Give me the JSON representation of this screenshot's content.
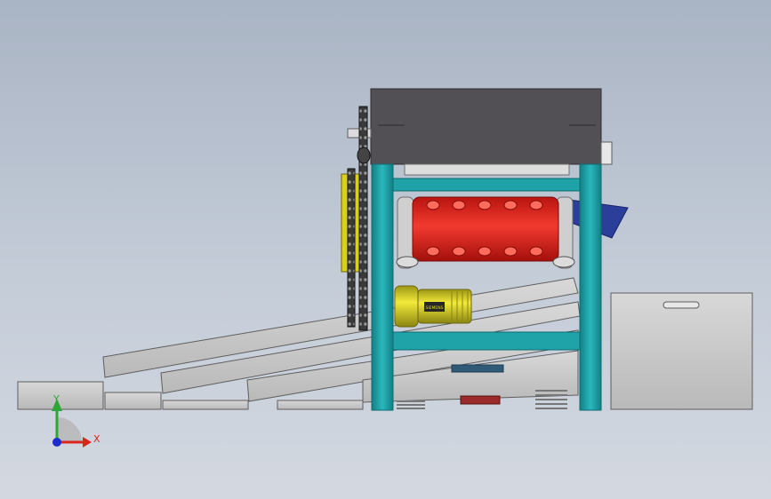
{
  "viewport": {
    "background_top": "#a9b4c4",
    "background_bottom": "#d3d8e0"
  },
  "colors": {
    "frame": "#1fa3a8",
    "frame_dark": "#0d6d72",
    "hopper": "#525055",
    "drum": "#e0201d",
    "motor": "#e5dd27",
    "plate": "#c9c9c9",
    "plate_edge": "#5e5e5e",
    "chain": "#2a2a2a",
    "blue_chute": "#2b3f9a"
  },
  "triad": {
    "x_label": "X",
    "y_label": "Y",
    "x_color": "#d8261d",
    "y_color": "#2ea537",
    "z_color": "#1c2cd0"
  },
  "motor_plate": "SIEMENS",
  "icons": [
    "coordinate-triad-icon"
  ]
}
